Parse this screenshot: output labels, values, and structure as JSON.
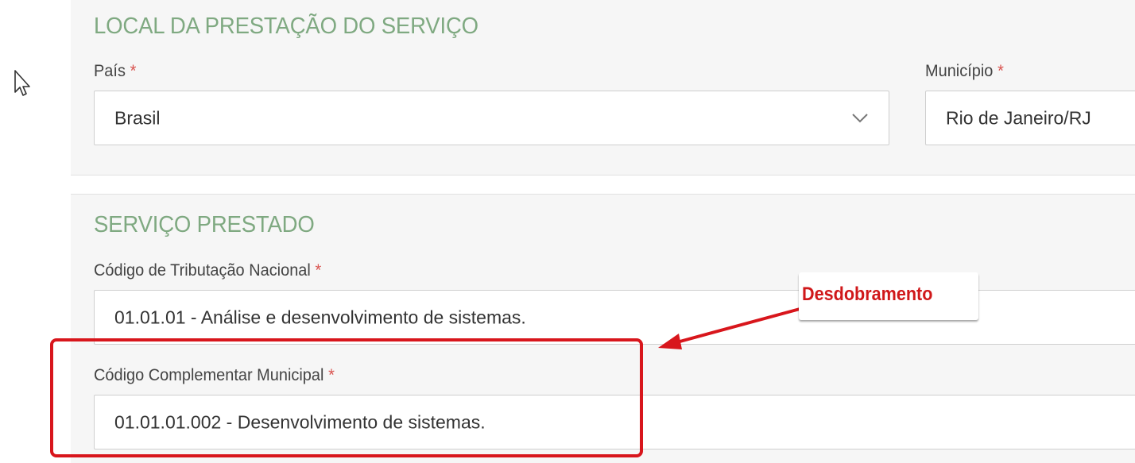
{
  "local": {
    "title": "LOCAL DA PRESTAÇÃO DO SERVIÇO",
    "pais": {
      "label": "País",
      "required": "*",
      "value": "Brasil",
      "icon": "chevron-down-icon"
    },
    "municipio": {
      "label": "Município",
      "required": "*",
      "value": "Rio de Janeiro/RJ"
    }
  },
  "servico": {
    "title": "SERVIÇO PRESTADO",
    "codigo_tributacao": {
      "label": "Código de Tributação Nacional",
      "required": "*",
      "value": "01.01.01 - Análise e desenvolvimento de sistemas."
    },
    "codigo_complementar": {
      "label": "Código Complementar Municipal",
      "required": "*",
      "value": "01.01.01.002 - Desenvolvimento de sistemas."
    }
  },
  "annotation": {
    "label": "Desdobramento",
    "color": "#d0181a"
  },
  "colors": {
    "section_title": "#7fa981",
    "required_marker": "#d9534f",
    "highlight": "#d8161c"
  }
}
